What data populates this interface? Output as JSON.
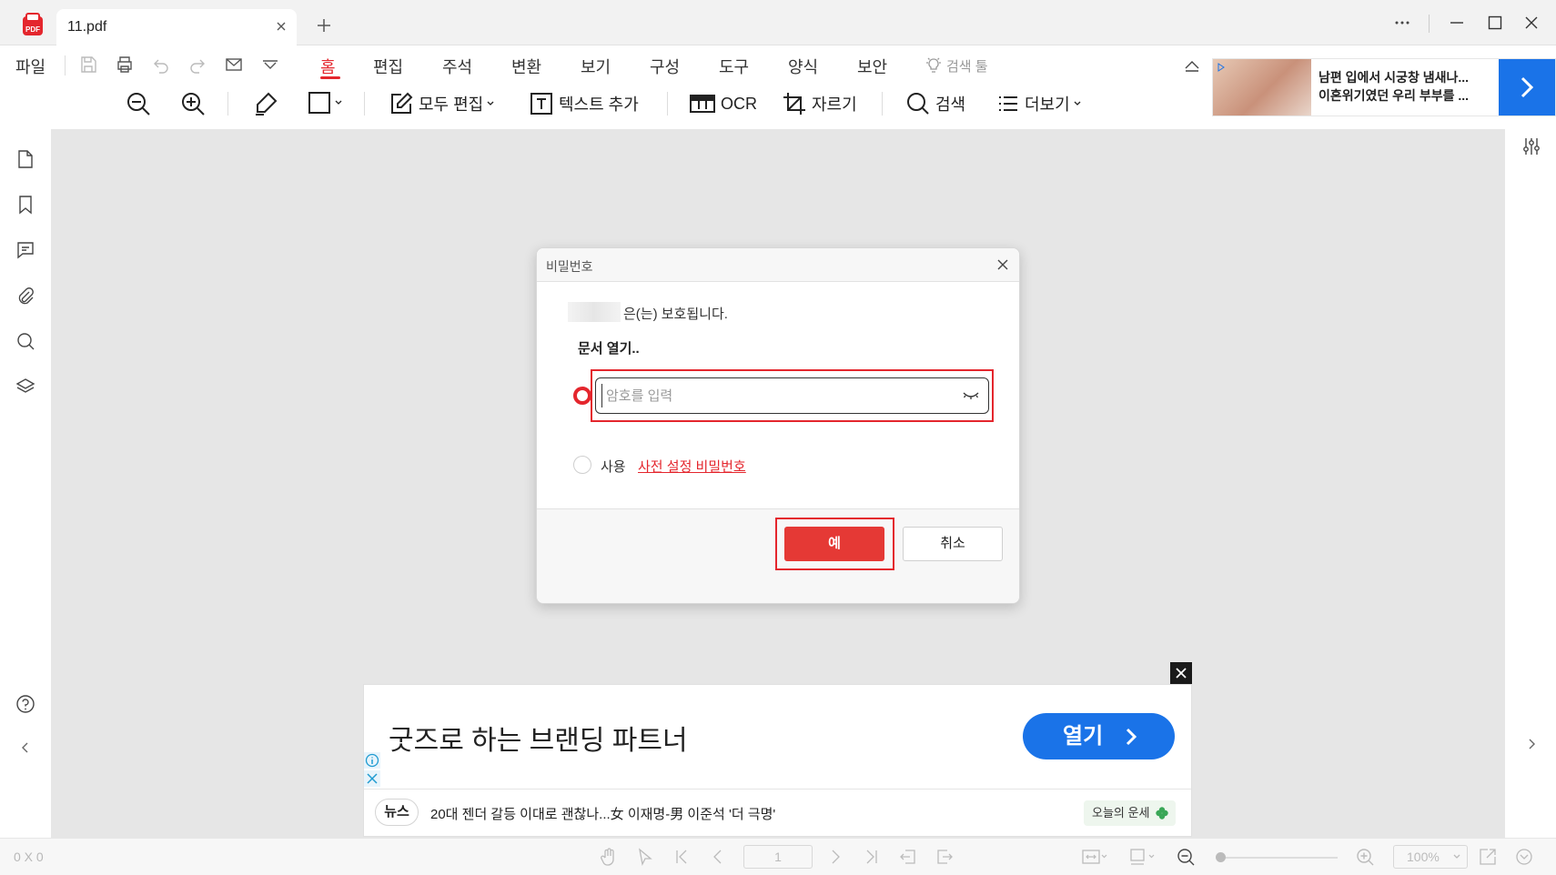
{
  "tab": {
    "title": "11.pdf"
  },
  "menu": [
    "파일",
    "홈",
    "편집",
    "주석",
    "변환",
    "보기",
    "구성",
    "도구",
    "양식",
    "보안",
    "검색 툴"
  ],
  "toolbar": {
    "edit_all": "모두 편집",
    "add_text": "텍스트 추가",
    "ocr": "OCR",
    "crop": "자르기",
    "search": "검색",
    "more": "더보기"
  },
  "ad_top": {
    "line1": "남편 입에서 시궁창 냄새나...",
    "line2": "이혼위기였던 우리 부부를 ..."
  },
  "dialog": {
    "title": "비밀번호",
    "protected_text": "은(는) 보호됩니다.",
    "open_label": "문서 열기..",
    "password_placeholder": "암호를 입력",
    "use_label": "사용",
    "preset_link": "사전 설정 비밀번호",
    "ok_label": "예",
    "cancel_label": "취소"
  },
  "ad_bottom": {
    "headline": "굿즈로 하는 브랜딩 파트너",
    "open_label": "열기",
    "news_badge": "뉴스",
    "news_text": "20대 젠더 갈등 이대로 괜찮나...女 이재명-男 이준석 '더 극명'",
    "fortune_label": "오늘의 운세"
  },
  "status": {
    "dimensions": "0 X 0",
    "page": "1",
    "zoom": "100%"
  },
  "colors": {
    "accent": "#e4262d",
    "ad_blue": "#1a73e8"
  }
}
